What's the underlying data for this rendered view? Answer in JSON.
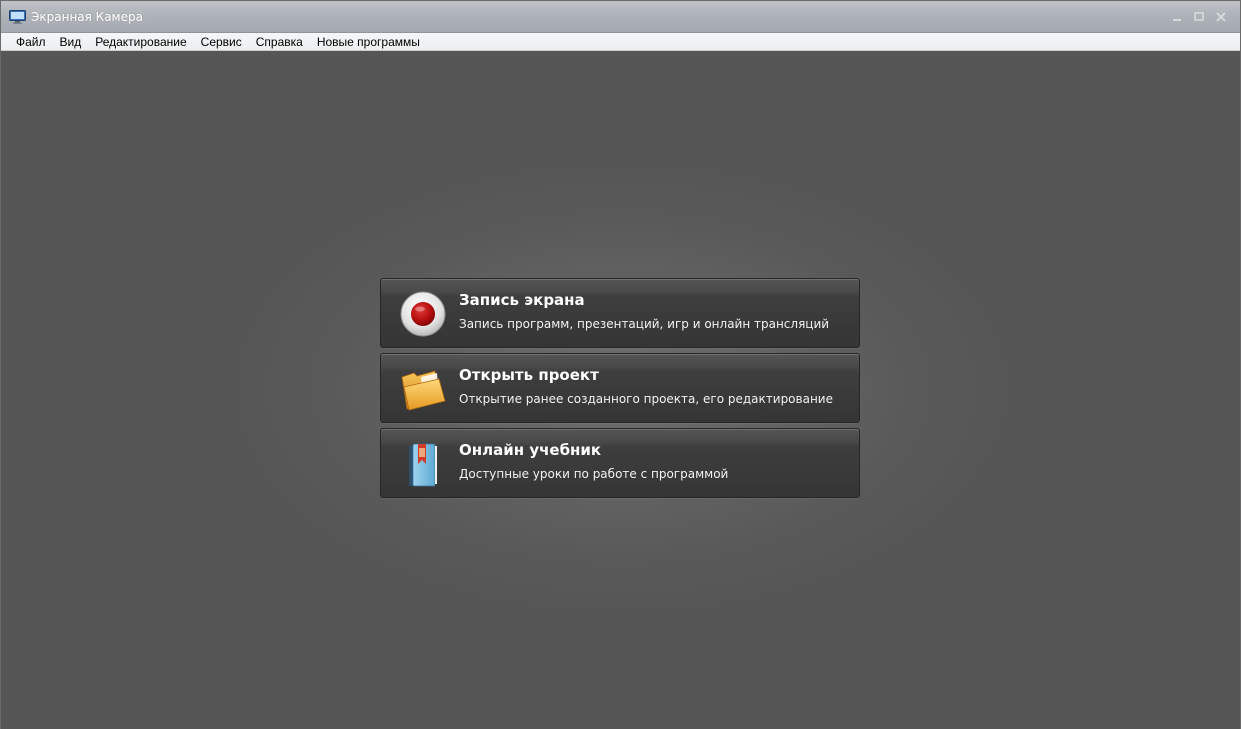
{
  "window": {
    "title": "Экранная Камера",
    "app_icon": "monitor-icon",
    "controls": [
      "minimize-icon",
      "maximize-icon",
      "close-icon"
    ]
  },
  "menubar": {
    "items": [
      {
        "label": "Файл"
      },
      {
        "label": "Вид"
      },
      {
        "label": "Редактирование"
      },
      {
        "label": "Сервис"
      },
      {
        "label": "Справка"
      },
      {
        "label": "Новые программы"
      }
    ]
  },
  "actions": [
    {
      "title": "Запись экрана",
      "description": "Запись программ, презентаций, игр и онлайн трансляций",
      "icon": "record-icon"
    },
    {
      "title": "Открыть проект",
      "description": "Открытие ранее созданного проекта, его редактирование",
      "icon": "folder-icon"
    },
    {
      "title": "Онлайн учебник",
      "description": "Доступные уроки по работе с программой",
      "icon": "book-icon"
    }
  ],
  "colors": {
    "workspace_bg": "#565656",
    "button_bg": "#3a3a3a",
    "record_red": "#b50f0f",
    "folder_orange": "#f0a92a",
    "book_blue": "#7fbfe0"
  }
}
